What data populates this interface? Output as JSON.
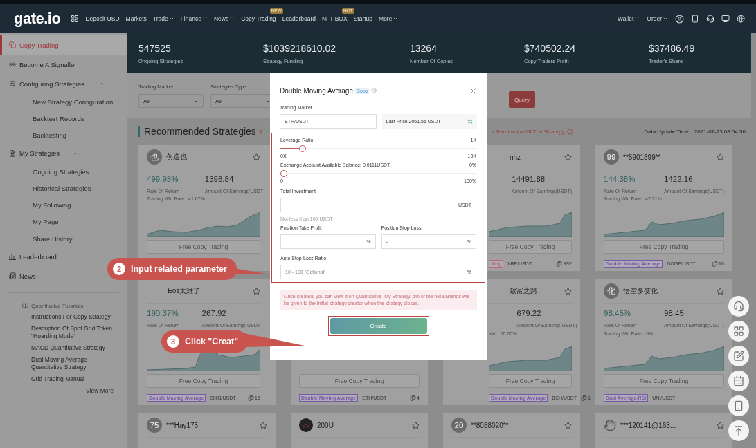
{
  "nav": {
    "logo": "gate.io",
    "items": [
      {
        "label": "Deposit USD",
        "dropdown": false
      },
      {
        "label": "Markets",
        "dropdown": false
      },
      {
        "label": "Trade",
        "dropdown": true
      },
      {
        "label": "Finance",
        "dropdown": true
      },
      {
        "label": "News",
        "dropdown": true
      },
      {
        "label": "Copy Trading",
        "dropdown": false,
        "badge": "NEW"
      },
      {
        "label": "Leaderboard",
        "dropdown": false
      },
      {
        "label": "NFT BOX",
        "dropdown": false,
        "badge": "HOT"
      },
      {
        "label": "Startup",
        "dropdown": false
      },
      {
        "label": "More",
        "dropdown": true
      }
    ],
    "right": [
      {
        "label": "Wallet"
      },
      {
        "label": "Order"
      }
    ]
  },
  "sidebar": {
    "items": [
      {
        "label": "Copy Trading",
        "kind": "copy",
        "selected": true
      },
      {
        "label": "Become A Signaller",
        "kind": "signal",
        "selected": false
      },
      {
        "label": "Configuring Strategies",
        "kind": "config",
        "selected": false,
        "expanded": true,
        "children": [
          {
            "label": "New Strategy Configuration",
            "selected": false
          },
          {
            "label": "Backtest Records",
            "selected": false
          },
          {
            "label": "Backtesting",
            "selected": false
          }
        ]
      },
      {
        "label": "My Strategies",
        "kind": "mine",
        "selected": false,
        "expanded": true,
        "children": [
          {
            "label": "Ongoing Strategies",
            "selected": false
          },
          {
            "label": "Historical Strategies",
            "selected": false
          },
          {
            "label": "My Following",
            "selected": false
          },
          {
            "label": "My Page",
            "selected": false
          },
          {
            "label": "Share History",
            "selected": false
          }
        ]
      },
      {
        "label": "Leaderboard",
        "kind": "board",
        "selected": false
      },
      {
        "label": "News",
        "kind": "news",
        "selected": false
      }
    ],
    "tutorials": {
      "title": "Quantitative Tutorials",
      "links": [
        "Instructions For Copy Strategy",
        "Description Of Spot Grid Token \"Hoarding Mode\"",
        "MACD Quantitative Strategy",
        "Dual Moving Average Quantitative Strategy",
        "Grid Trading Manual"
      ],
      "more": "View More"
    }
  },
  "stats": [
    {
      "value": "547525",
      "label": "Ongoing Strategies"
    },
    {
      "value": "$1039218610.02",
      "label": "Strategy Funding"
    },
    {
      "value": "13264",
      "label": "Number Of Copies"
    },
    {
      "value": "$740502.24",
      "label": "Copy Traders Profit"
    },
    {
      "value": "$37486.49",
      "label": "Trader's Share"
    }
  ],
  "filters": [
    {
      "label": "Trading Market:",
      "value": "All"
    },
    {
      "label": "Strategies Type",
      "value": "All"
    }
  ],
  "query_button": "Query",
  "section": {
    "title": "Recommended Strategies",
    "note_left": "A",
    "note_right": "n Termination Of The Strategy",
    "update_time": "Data Update Time：2021-07-23 08:54:56"
  },
  "cards": [
    {
      "avatar": {
        "kind": "letter",
        "text": "也"
      },
      "name": "创造也",
      "rate": "499.93%",
      "earnings": "1398.84",
      "rate_label": "Rate Of Return",
      "earnings_label": "Amount Of Earnings(USDT",
      "win_rate": "Trading Win Rate : 41.67%",
      "button": "Free Copy Trading"
    },
    {
      "name": "nhz",
      "earnings": "14491.88",
      "earnings_label": "Amount Of Earnings(USDT)",
      "button": "Free Copy Trading",
      "tag": {
        "text": "ding",
        "color": "#c0686b"
      },
      "pair": "XRP/USDT",
      "copies": "992"
    },
    {
      "avatar": {
        "kind": "letter",
        "text": "99"
      },
      "name": "**5901899**",
      "rate": "144.38%",
      "earnings": "1422.16",
      "rate_label": "Rate Of Return",
      "earnings_label": "Amount Of Earnings(USDT)",
      "win_rate": "Trading Win Rate : 42.31%",
      "button": "Free Copy Trading",
      "tag": {
        "text": "Double Moving Average",
        "color": "#7a5aa6"
      },
      "pair": "DOGE/USDT",
      "copies": "10"
    },
    {
      "name": "Eos太难了",
      "rate": "190.37%",
      "earnings": "267.92",
      "rate_label": "Rate Of Return",
      "earnings_label": "Amount Of Earnings(USDT",
      "button": "Free Copy Trading",
      "tag": {
        "text": "Double Moving Average",
        "color": "#7a5aa6"
      },
      "pair": "SHIB/USDT",
      "copies": "15"
    },
    {
      "button": "Free Copy Trading",
      "tag": {
        "text": "Double Moving Average",
        "color": "#7a5aa6"
      },
      "pair": "ETH/USDT",
      "copies": "4"
    },
    {
      "name": "致富之路",
      "earnings": "679.22",
      "earnings_label": "Amount Of Earnings(USDT)",
      "win_rate": "ate：50.00%",
      "button": "Free Copy Trading",
      "tag": {
        "text": "Double Moving Average",
        "color": "#7a5aa6"
      },
      "pair": "BCH/USDT",
      "copies": "1"
    },
    {
      "avatar": {
        "kind": "letter",
        "text": "化"
      },
      "name": "悟空多变化",
      "rate": "98.45%",
      "earnings": "98.45",
      "rate_label": "Rate Of Return",
      "earnings_label": "Amount Of Earnings(USDT)",
      "win_rate": "Trading Win Rate：0%",
      "button": "Free Copy Trading",
      "tag": {
        "text": "Dual Average-RSI",
        "color": "#7a5aa6"
      },
      "pair": "UNI/USDT"
    },
    {
      "avatar": {
        "kind": "letter",
        "text": "75"
      },
      "name": "***Hay175"
    },
    {
      "avatar": {
        "kind": "logo"
      },
      "name": "200U"
    },
    {
      "avatar": {
        "kind": "letter",
        "text": "20"
      },
      "name": "**8088020**"
    },
    {
      "avatar": {
        "kind": "hand"
      },
      "name": "***120141@163..."
    }
  ],
  "modal": {
    "title": "Double Moving Average",
    "tag": "Copy",
    "market_label": "Trading Market",
    "market_value": "ETH/USDT",
    "last_price": "Last Price 2061.55 USDT",
    "sliders": [
      {
        "label": "Leverage Ratio",
        "reading": "1X",
        "level": 0.1,
        "min": "0X",
        "max": "10X"
      },
      {
        "label": "Exchange Account Available Balance: 0.0111USDT",
        "reading": "0%",
        "level": 0,
        "min": "0",
        "max": "100%"
      }
    ],
    "investment": {
      "label": "Total Investment",
      "unit": "USDT",
      "hint": "Not less than 100 USDT"
    },
    "take_profit": {
      "label": "Position Take Profit",
      "unit": "%"
    },
    "stop_loss": {
      "label": "Position Stop Loss",
      "value": "-",
      "unit": "%"
    },
    "auto_stop": {
      "label": "Auto Stop-Loss Ratio",
      "placeholder": "10 - 100 (Optional)",
      "unit": "%"
    },
    "notice": "Once created, you can view it on Quantitative- My Strategy. 5% of the net earnings will be given to the initial strategy creator when the strategy closes.",
    "create_button": "Create"
  },
  "callouts": [
    {
      "step": "2",
      "text": "Input related parameter"
    },
    {
      "step": "3",
      "text": "Click \"Creat\""
    }
  ]
}
